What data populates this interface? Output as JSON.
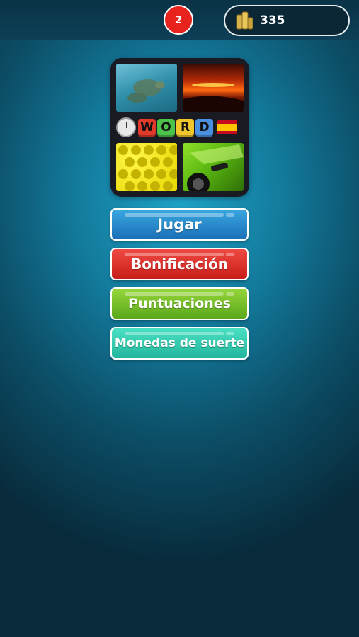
{
  "header": {
    "notification_count": "2",
    "coins": "335"
  },
  "logo": {
    "letters": [
      "W",
      "O",
      "R",
      "D"
    ],
    "letter_colors": [
      "#e23a2a",
      "#4cc24a",
      "#f0c62a",
      "#4a8fe0"
    ],
    "flag": "spain"
  },
  "menu": {
    "play_label": "Jugar",
    "bonus_label": "Bonificación",
    "scores_label": "Puntuaciones",
    "lucky_coins_label": "Monedas de suerte"
  },
  "colors": {
    "play": "#2a8ccc",
    "bonus": "#e0302b",
    "scores": "#7cc22a",
    "lucky": "#35cdb0",
    "badge": "#e8221d"
  }
}
